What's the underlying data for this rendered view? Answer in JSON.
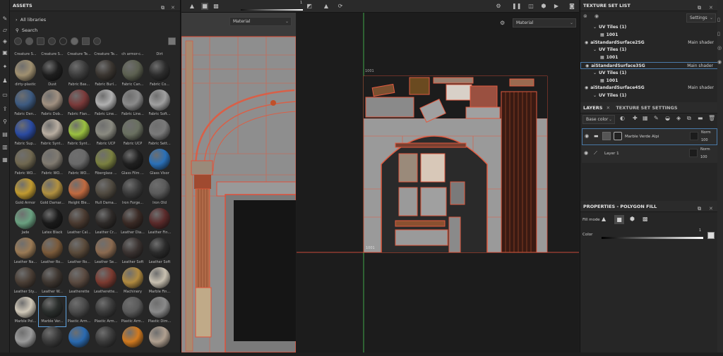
{
  "assets": {
    "title": "ASSETS",
    "all_libraries": "All libraries",
    "search_label": "Search",
    "top_row_labels": [
      "Creature S...",
      "Creature S...",
      "Creature Te...",
      "Creature Te...",
      "ch armor-c...",
      "Dirt"
    ],
    "items": [
      {
        "label": "dirty-plastic",
        "color": "#a09070"
      },
      {
        "label": "Dust",
        "color": "#1e1e1e"
      },
      {
        "label": "Fabric Bas...",
        "color": "#3c3c3c"
      },
      {
        "label": "Fabric Burl...",
        "color": "#3a3530"
      },
      {
        "label": "Fabric Can...",
        "color": "#5c6050"
      },
      {
        "label": "Fabric Co...",
        "color": "#2c2c2c"
      },
      {
        "label": "Fabric Den...",
        "color": "#3d5a80"
      },
      {
        "label": "Fabric Dob...",
        "color": "#a09080"
      },
      {
        "label": "Fabric Flan...",
        "color": "#7a3a3a"
      },
      {
        "label": "Fabric Line...",
        "color": "#b0b0b0"
      },
      {
        "label": "Fabric Line...",
        "color": "#8a8a8a"
      },
      {
        "label": "Fabric Soft...",
        "color": "#a0a0a0"
      },
      {
        "label": "Fabric Sup...",
        "color": "#2a4aa0"
      },
      {
        "label": "Fabric Synt...",
        "color": "#b8ada0"
      },
      {
        "label": "Fabric Synt...",
        "color": "#9ac040"
      },
      {
        "label": "Fabric UCP",
        "color": "#8a8a80"
      },
      {
        "label": "Fabric UCP",
        "color": "#6a7060"
      },
      {
        "label": "Fabric Sett...",
        "color": "#7a7a7a"
      },
      {
        "label": "Fabric WO...",
        "color": "#706850"
      },
      {
        "label": "Fabric WO...",
        "color": "#807a70"
      },
      {
        "label": "Fabric WO...",
        "color": "#6a6a6a"
      },
      {
        "label": "Fiberglass ...",
        "color": "#7a8040"
      },
      {
        "label": "Glass Film ...",
        "color": "#202020"
      },
      {
        "label": "Glass Visor",
        "color": "#2a70b8"
      },
      {
        "label": "Gold Armor",
        "color": "#c09a30"
      },
      {
        "label": "Gold Damar...",
        "color": "#b09040"
      },
      {
        "label": "Height Ble...",
        "color": "#c06a40"
      },
      {
        "label": "Hull Dama...",
        "color": "#504a40"
      },
      {
        "label": "Iron Forge...",
        "color": "#3a3a3a"
      },
      {
        "label": "Iron Old",
        "color": "#5a5a5a"
      },
      {
        "label": "Jade",
        "color": "#6aa080"
      },
      {
        "label": "Latex Black",
        "color": "#1a1a1a"
      },
      {
        "label": "Leather Cal...",
        "color": "#4a3a30"
      },
      {
        "label": "Leather Cr...",
        "color": "#2e2a28"
      },
      {
        "label": "Leather Dia...",
        "color": "#3a2a25"
      },
      {
        "label": "Leather Fin...",
        "color": "#5a2a2a"
      },
      {
        "label": "Leather Na...",
        "color": "#9a7a55"
      },
      {
        "label": "Leather Ro...",
        "color": "#7a5a3a"
      },
      {
        "label": "Leather Ro...",
        "color": "#5a4a3a"
      },
      {
        "label": "Leather Se...",
        "color": "#8a6a50"
      },
      {
        "label": "Leather Soft",
        "color": "#3a3230"
      },
      {
        "label": "Leather Soft",
        "color": "#2a2a2a"
      },
      {
        "label": "Leather Sty...",
        "color": "#4a3e35"
      },
      {
        "label": "Leather W...",
        "color": "#3e3630"
      },
      {
        "label": "Leatherette",
        "color": "#5a4a40"
      },
      {
        "label": "Leatherette...",
        "color": "#7a3a30"
      },
      {
        "label": "Machinery",
        "color": "#b08a40"
      },
      {
        "label": "Marble Fin...",
        "color": "#c8c0b0"
      },
      {
        "label": "Marble Pol...",
        "color": "#d0c8b8"
      },
      {
        "label": "Marble Ver...",
        "color": "#2a2e2c"
      },
      {
        "label": "Plastic Arm...",
        "color": "#4a4a4a"
      },
      {
        "label": "Plastic Arm...",
        "color": "#3a3a3a"
      },
      {
        "label": "Plastic Arm...",
        "color": "#5a5a5a"
      },
      {
        "label": "Plastic Dim...",
        "color": "#8a8a8a"
      },
      {
        "label": "",
        "color": "#9a9a9a"
      },
      {
        "label": "",
        "color": "#3a3a3a"
      },
      {
        "label": "",
        "color": "#2a6ab0"
      },
      {
        "label": "",
        "color": "#3a3a3a"
      },
      {
        "label": "",
        "color": "#d07a20"
      },
      {
        "label": "",
        "color": "#b0a090"
      }
    ]
  },
  "viewport": {
    "left_material": "Material",
    "right_material": "Material",
    "uv_tile_top": "1001",
    "uv_tile_bottom": "1001",
    "slider_value": "1"
  },
  "texture_set_list": {
    "title": "TEXTURE SET LIST",
    "settings_label": "Settings",
    "rows": [
      {
        "type": "uvtiles",
        "label": "UV Tiles (1)"
      },
      {
        "type": "tile",
        "label": "1001"
      },
      {
        "type": "set",
        "label": "aiStandardSurface2SG",
        "shader": "Main shader"
      },
      {
        "type": "uvtiles",
        "label": "UV Tiles (1)"
      },
      {
        "type": "tile",
        "label": "1001"
      },
      {
        "type": "set",
        "label": "aiStandardSurface3SG",
        "shader": "Main shader"
      },
      {
        "type": "uvtiles",
        "label": "UV Tiles (1)"
      },
      {
        "type": "tile",
        "label": "1001"
      },
      {
        "type": "set",
        "label": "aiStandardSurface4SG",
        "shader": "Main shader"
      },
      {
        "type": "uvtiles",
        "label": "UV Tiles (1)"
      }
    ]
  },
  "layers": {
    "tab_layers": "LAYERS",
    "tab_settings": "TEXTURE SET SETTINGS",
    "channel": "Base color",
    "items": [
      {
        "name": "Marble Verde Alpi",
        "blend": "Norm",
        "opacity": "100"
      },
      {
        "name": "Layer 1",
        "blend": "Norm",
        "opacity": "100"
      }
    ]
  },
  "properties": {
    "title": "PROPERTIES - POLYGON FILL",
    "fill_mode_label": "Fill mode",
    "color_label": "Color",
    "color_value": "1"
  }
}
